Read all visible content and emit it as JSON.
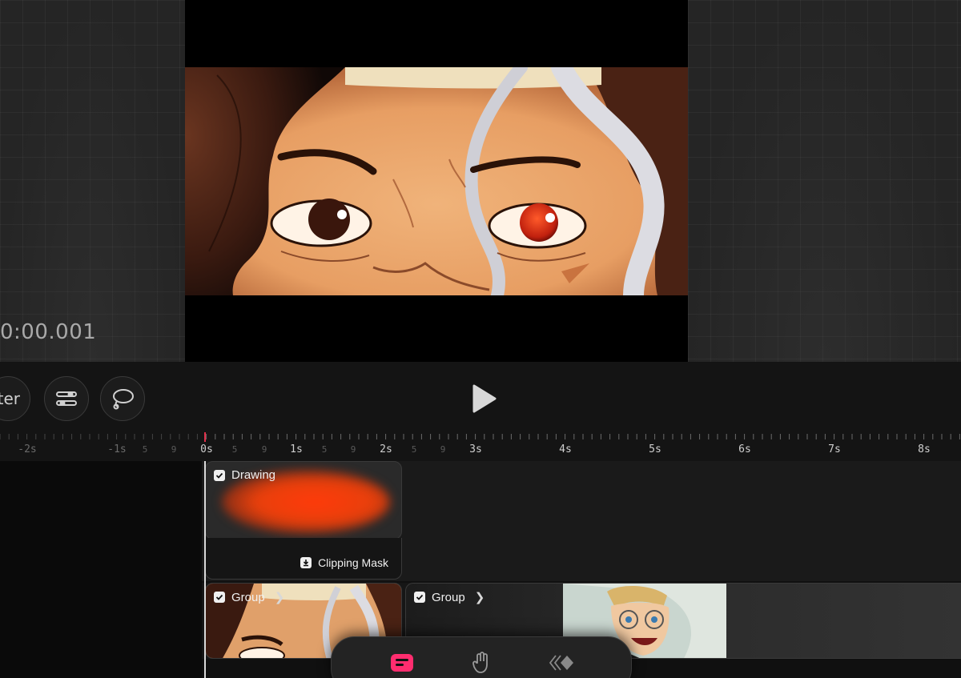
{
  "viewer": {
    "timecode": "0:00.001"
  },
  "controls": {
    "filter_label": "ter",
    "icons": [
      "sliders-icon",
      "lasso-icon",
      "play-icon"
    ]
  },
  "ruler": {
    "labels": [
      "-2s",
      "-1s",
      "0s",
      "1s",
      "2s",
      "3s",
      "4s",
      "5s",
      "6s",
      "7s",
      "8s"
    ],
    "frame_labels": [
      "5",
      "9",
      "5",
      "9",
      "5",
      "9",
      "5",
      "9"
    ],
    "playhead_color": "#e0304a"
  },
  "tracks": {
    "drawing_clip": {
      "label": "Drawing",
      "checked": true
    },
    "clipping_mask": {
      "label": "Clipping Mask"
    },
    "group_clip_1": {
      "label": "Group",
      "checked": true
    },
    "group_clip_2": {
      "label": "Group",
      "checked": true
    }
  },
  "dock": {
    "items": [
      "timeline-icon",
      "hand-icon",
      "keyframes-icon"
    ],
    "active_color": "#ff2d6f"
  },
  "colors": {
    "background": "#0d0d0d",
    "accent_orange": "#ff3a0a"
  }
}
